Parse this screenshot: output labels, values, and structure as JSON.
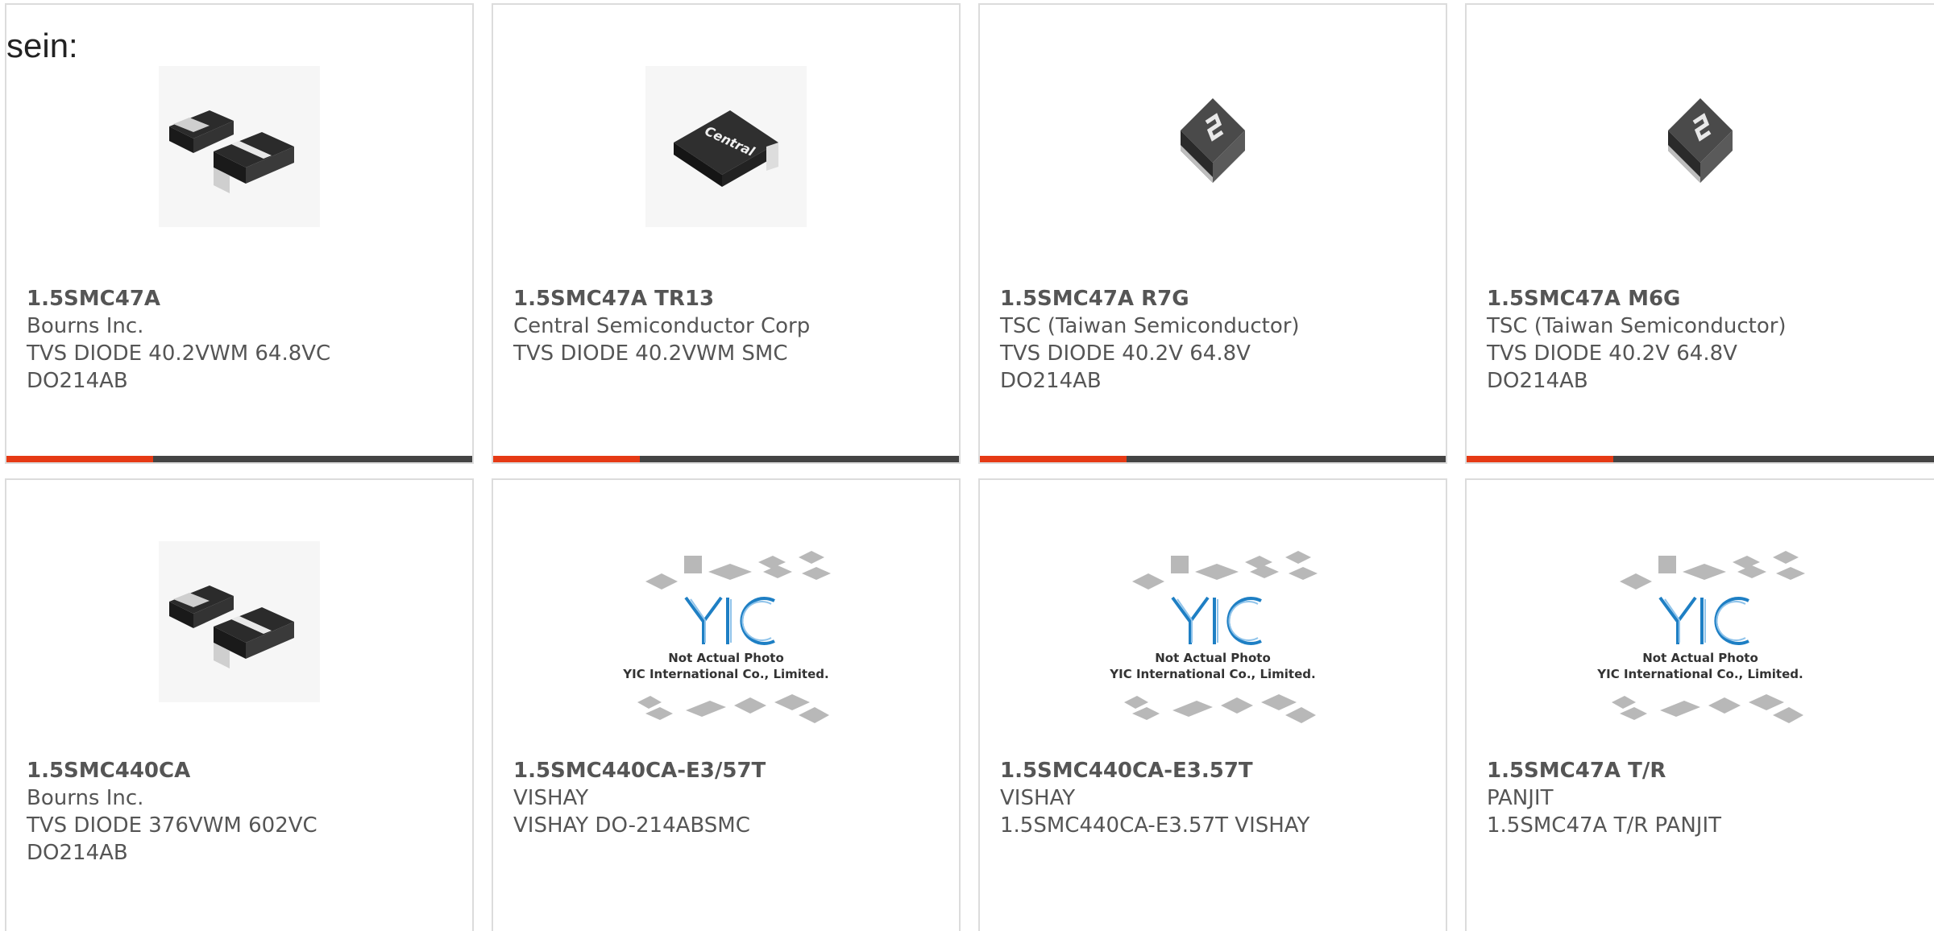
{
  "lead_text": "sein:",
  "cards": [
    {
      "part": "1.5SMC47A",
      "maker": "Bourns Inc.",
      "desc_line1": "TVS DIODE 40.2VWM 64.8VC",
      "desc_line2": "DO214AB",
      "image": "smc-diode-pair-photo"
    },
    {
      "part": "1.5SMC47A TR13",
      "maker": "Central Semiconductor Corp",
      "desc_line1": "TVS DIODE 40.2VWM SMC",
      "desc_line2": "",
      "image": "central-smc-diode-photo",
      "image_label": "Central"
    },
    {
      "part": "1.5SMC47A R7G",
      "maker": "TSC (Taiwan Semiconductor)",
      "desc_line1": "TVS DIODE 40.2V 64.8V",
      "desc_line2": "DO214AB",
      "image": "tsc-diode-photo"
    },
    {
      "part": "1.5SMC47A M6G",
      "maker": "TSC (Taiwan Semiconductor)",
      "desc_line1": "TVS DIODE 40.2V 64.8V",
      "desc_line2": "DO214AB",
      "image": "tsc-diode-photo"
    },
    {
      "part": "1.5SMC440CA",
      "maker": "Bourns Inc.",
      "desc_line1": "TVS DIODE 376VWM 602VC",
      "desc_line2": "DO214AB",
      "image": "smc-diode-pair-photo"
    },
    {
      "part": "1.5SMC440CA-E3/57T",
      "maker": "VISHAY",
      "desc_line1": "VISHAY DO-214ABSMC",
      "desc_line2": "",
      "image": "yic-placeholder",
      "placeholder_line1": "Not Actual Photo",
      "placeholder_line2": "YIC International Co., Limited."
    },
    {
      "part": "1.5SMC440CA-E3.57T",
      "maker": "VISHAY",
      "desc_line1": "1.5SMC440CA-E3.57T VISHAY",
      "desc_line2": "",
      "image": "yic-placeholder",
      "placeholder_line1": "Not Actual Photo",
      "placeholder_line2": "YIC International Co., Limited."
    },
    {
      "part": "1.5SMC47A T/R",
      "maker": "PANJIT",
      "desc_line1": "1.5SMC47A T/R PANJIT",
      "desc_line2": "",
      "image": "yic-placeholder",
      "placeholder_line1": "Not Actual Photo",
      "placeholder_line2": "YIC International Co., Limited."
    }
  ],
  "colors": {
    "accent": "#e63a15",
    "bar": "#444444",
    "border": "#dcdcdc",
    "text": "#555555",
    "logo_blue": "#1e7fc4"
  }
}
